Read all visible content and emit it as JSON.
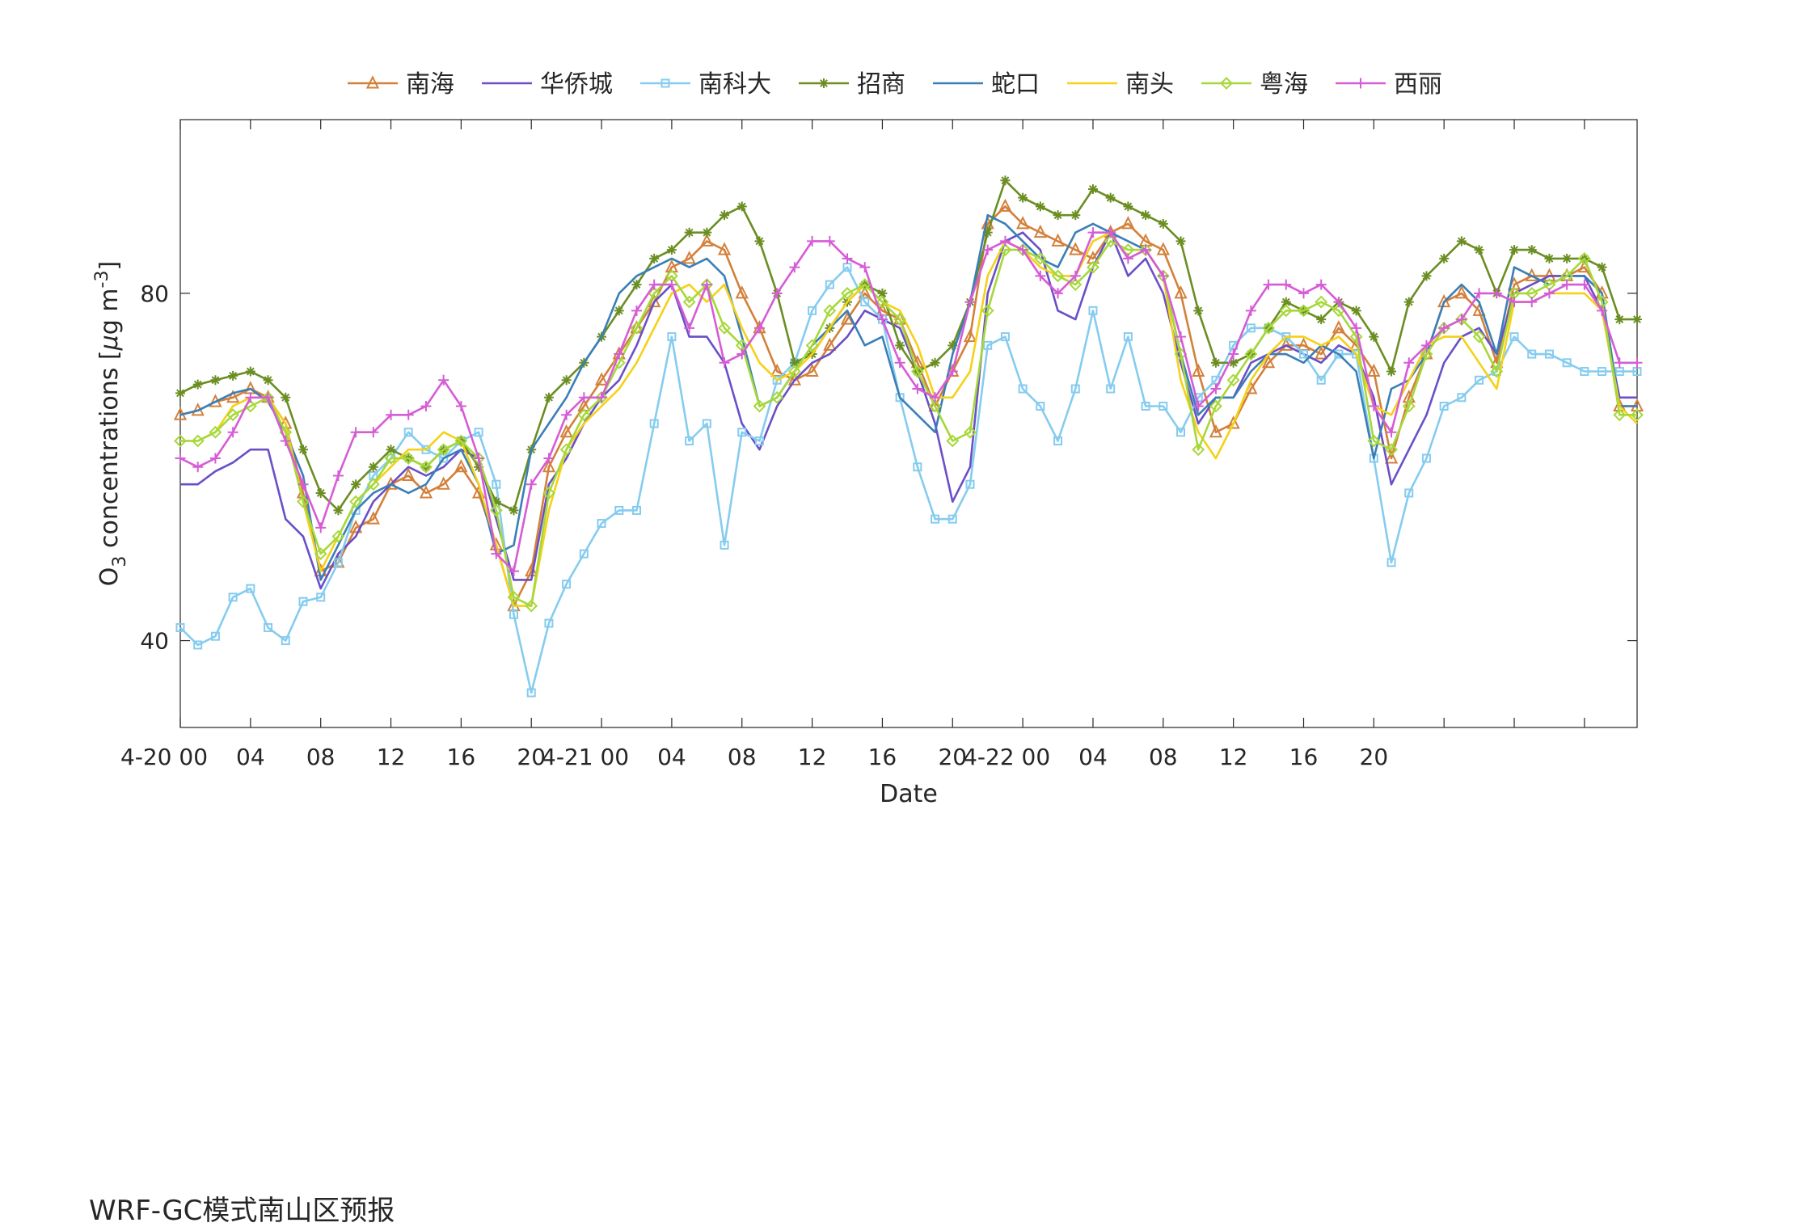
{
  "chart_data": {
    "type": "line",
    "xlabel": "Date",
    "ylabel": "O3 concentrations [μg m-3]",
    "ylabel_parts": {
      "base": "O",
      "sub": "3",
      "mid": " concentrations [",
      "mu": "μ",
      "g": "g m",
      "sup": "-3",
      "end": "]"
    },
    "ylim": [
      30,
      100
    ],
    "xlim": [
      0,
      83
    ],
    "yticks": [
      40,
      80
    ],
    "xticks": [
      {
        "x": 0,
        "label": "4-20 00"
      },
      {
        "x": 4,
        "label": "04"
      },
      {
        "x": 8,
        "label": "08"
      },
      {
        "x": 12,
        "label": "12"
      },
      {
        "x": 16,
        "label": "16"
      },
      {
        "x": 20,
        "label": "20"
      },
      {
        "x": 24,
        "label": "4-21 00"
      },
      {
        "x": 28,
        "label": "04"
      },
      {
        "x": 32,
        "label": "08"
      },
      {
        "x": 36,
        "label": "12"
      },
      {
        "x": 40,
        "label": "16"
      },
      {
        "x": 44,
        "label": "20"
      },
      {
        "x": 48,
        "label": "4-22 00"
      },
      {
        "x": 52,
        "label": "04"
      },
      {
        "x": 56,
        "label": "08"
      },
      {
        "x": 60,
        "label": "12"
      },
      {
        "x": 64,
        "label": "16"
      },
      {
        "x": 68,
        "label": "20"
      }
    ],
    "minor_ticks": [
      72,
      76,
      80
    ],
    "grid": false,
    "legend_position": "top-center",
    "series": [
      {
        "name": "南海",
        "color": "#D3803A",
        "marker": "triangle",
        "values": [
          66,
          66.5,
          67.5,
          68,
          69,
          68,
          65,
          57,
          48,
          49,
          53,
          54,
          58,
          59,
          57,
          58,
          60,
          57,
          51,
          44,
          48,
          60,
          64,
          67,
          70,
          73,
          76,
          79,
          83,
          84,
          86,
          85,
          80,
          76,
          71,
          70,
          71,
          74,
          77,
          80,
          78,
          77,
          72,
          67,
          71,
          75,
          88,
          90,
          88,
          87,
          86,
          85,
          84,
          87,
          88,
          86,
          85,
          80,
          71,
          64,
          65,
          69,
          72,
          74,
          74,
          73,
          76,
          74,
          71,
          61,
          68,
          73,
          79,
          80,
          78,
          72,
          81,
          82,
          82,
          82,
          83,
          80,
          67,
          67
        ]
      },
      {
        "name": "华侨城",
        "color": "#6A4FC8",
        "marker": "none",
        "values": [
          58,
          58,
          59.5,
          60.5,
          62,
          62,
          54,
          52,
          46,
          50,
          52,
          56,
          58,
          60,
          59,
          60,
          62,
          61,
          54,
          47,
          47,
          58,
          61,
          65,
          68,
          70,
          74,
          79,
          81,
          75,
          75,
          72,
          65,
          62,
          67,
          70,
          72,
          73,
          75,
          78,
          77,
          76,
          71,
          65,
          56,
          60,
          80,
          86,
          87,
          85,
          78,
          77,
          83,
          87,
          82,
          84,
          80,
          72,
          65,
          68,
          68,
          72,
          73,
          74,
          73,
          72,
          74,
          73,
          68,
          58,
          62,
          66,
          72,
          75,
          76,
          73,
          80,
          81,
          82,
          82,
          82,
          78,
          68,
          68
        ]
      },
      {
        "name": "南科大",
        "color": "#85CCEF",
        "marker": "square",
        "values": [
          41.5,
          39.5,
          40.5,
          45,
          46,
          41.5,
          40,
          44.5,
          45,
          49,
          55,
          59,
          61,
          64,
          62,
          61,
          63,
          64,
          58,
          43,
          34,
          42,
          46.5,
          50,
          53.5,
          55,
          55,
          65,
          75,
          63,
          65,
          51,
          64,
          63,
          70,
          72,
          78,
          81,
          83,
          79,
          77,
          68,
          60,
          54,
          54,
          58,
          74,
          75,
          69,
          67,
          63,
          69,
          78,
          69,
          75,
          67,
          67,
          64,
          68,
          70,
          74,
          76,
          76,
          75,
          73,
          70,
          73,
          73,
          61,
          49,
          57,
          61,
          67,
          68,
          70,
          71,
          75,
          73,
          73,
          72,
          71,
          71,
          71,
          71
        ]
      },
      {
        "name": "招商",
        "color": "#6B8E23",
        "marker": "star",
        "values": [
          68.5,
          69.5,
          70,
          70.5,
          71,
          70,
          68,
          62,
          57,
          55,
          58,
          60,
          62,
          61,
          60,
          62,
          63,
          60,
          56,
          55,
          62,
          68,
          70,
          72,
          75,
          78,
          81,
          84,
          85,
          87,
          87,
          89,
          90,
          86,
          80,
          72,
          73,
          76,
          79,
          81,
          80,
          74,
          71,
          72,
          74,
          79,
          87,
          93,
          91,
          90,
          89,
          89,
          92,
          91,
          90,
          89,
          88,
          86,
          78,
          72,
          72,
          73,
          76,
          79,
          78,
          77,
          79,
          78,
          75,
          71,
          79,
          82,
          84,
          86,
          85,
          80,
          85,
          85,
          84,
          84,
          84,
          83,
          77,
          77
        ]
      },
      {
        "name": "蛇口",
        "color": "#3A7FB8",
        "marker": "none",
        "values": [
          66,
          66.5,
          67.5,
          68.5,
          69,
          67.5,
          64,
          59,
          47,
          51,
          55,
          57,
          58,
          57,
          58,
          61,
          62,
          58,
          50,
          51,
          62,
          65,
          68,
          72,
          75,
          80,
          82,
          83,
          84,
          83,
          84,
          82,
          75,
          67,
          68,
          71,
          74,
          76,
          78,
          74,
          75,
          68,
          66,
          64,
          73,
          79,
          89,
          88,
          86,
          84,
          83,
          87,
          88,
          87,
          86,
          85,
          82,
          73,
          66,
          68,
          68,
          71,
          73,
          73,
          72,
          74,
          73,
          71,
          61,
          69,
          70,
          73,
          79,
          81,
          79,
          73,
          83,
          82,
          81,
          82,
          82,
          80,
          67,
          67
        ]
      },
      {
        "name": "南头",
        "color": "#F5D117",
        "marker": "none",
        "values": [
          63,
          63,
          64,
          67,
          68,
          68,
          65,
          56,
          48,
          52,
          56,
          58,
          60,
          62,
          62,
          64,
          63,
          58,
          51,
          44,
          44,
          55,
          62,
          65,
          67,
          69,
          72,
          76,
          80,
          81,
          79,
          81,
          76,
          72,
          70,
          71,
          73,
          76,
          79,
          81,
          79,
          78,
          74,
          68,
          68,
          71,
          82,
          86,
          85,
          83,
          82,
          82,
          86,
          87,
          84,
          85,
          82,
          70,
          64,
          61,
          65,
          70,
          73,
          75,
          75,
          74,
          75,
          73,
          67,
          66,
          70,
          74,
          75,
          75,
          72,
          69,
          79,
          79,
          80,
          80,
          80,
          78,
          67,
          65
        ]
      },
      {
        "name": "粤海",
        "color": "#A6D83A",
        "marker": "diamond",
        "values": [
          63,
          63,
          64,
          66,
          67,
          68,
          64,
          56,
          50,
          52,
          56,
          58,
          61,
          61,
          60,
          62,
          63,
          61,
          55,
          45,
          44,
          57,
          62,
          66,
          68,
          72,
          76,
          80,
          82,
          79,
          81,
          76,
          74,
          67,
          68,
          71,
          74,
          78,
          80,
          81,
          79,
          77,
          71,
          67,
          63,
          64,
          78,
          85,
          85,
          84,
          82,
          81,
          83,
          86,
          85,
          85,
          82,
          73,
          62,
          67,
          70,
          73,
          76,
          78,
          78,
          79,
          78,
          75,
          63,
          62,
          67,
          73,
          76,
          77,
          75,
          71,
          80,
          80,
          81,
          82,
          84,
          79,
          66,
          66
        ]
      },
      {
        "name": "西丽",
        "color": "#D65CD6",
        "marker": "plus",
        "values": [
          61,
          60,
          61,
          64,
          68,
          68,
          63,
          58,
          53,
          59,
          64,
          64,
          66,
          66,
          67,
          70,
          67,
          61,
          50,
          48,
          58,
          61,
          66,
          68,
          68,
          73,
          78,
          81,
          81,
          76,
          81,
          72,
          73,
          76,
          80,
          83,
          86,
          86,
          84,
          83,
          77,
          72,
          69,
          68,
          71,
          79,
          85,
          86,
          85,
          82,
          80,
          82,
          87,
          87,
          84,
          85,
          82,
          75,
          67,
          69,
          73,
          78,
          81,
          81,
          80,
          81,
          79,
          76,
          67,
          64,
          72,
          74,
          76,
          77,
          80,
          80,
          79,
          79,
          80,
          81,
          81,
          78,
          72,
          72
        ]
      }
    ]
  },
  "caption": "WRF-GC模式南山区预报"
}
